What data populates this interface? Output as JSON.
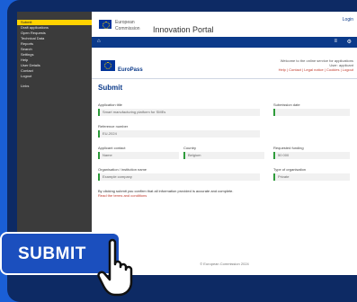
{
  "sidebar": {
    "items": [
      {
        "label": "Submit",
        "active": true
      },
      {
        "label": "Draft applications"
      },
      {
        "label": "Open Requests"
      },
      {
        "label": "Technical Data"
      },
      {
        "label": "Reports"
      },
      {
        "label": "Search"
      },
      {
        "label": "Settings"
      },
      {
        "label": "Help"
      },
      {
        "label": "User Details"
      },
      {
        "label": "Contact"
      },
      {
        "label": "Logout"
      }
    ],
    "section": "Links"
  },
  "header": {
    "org_line1": "European",
    "org_line2": "Commission",
    "portal_title": "Innovation Portal",
    "top_right": "Login"
  },
  "bluebar": {
    "home_glyph": "⌂",
    "right_glyphs": [
      "≡",
      "⚙"
    ]
  },
  "app": {
    "name": "EuroPass",
    "info_line1": "Welcome to the online service for applications",
    "info_line2": "User: applicant",
    "links": "Help | Contact | Legal notice | Cookies | Logout"
  },
  "form": {
    "title": "Submit",
    "fields": [
      {
        "label": "Application title",
        "value": "Smart manufacturing platform for SMEs"
      },
      {
        "label": "Submission date",
        "value": ""
      },
      {
        "label": "Reference number",
        "value": "EU-2024"
      },
      {
        "label": "Applicant contact",
        "value": "Name"
      },
      {
        "label": "Country",
        "value": "Belgium"
      },
      {
        "label": "Requested funding",
        "value": "50 000"
      },
      {
        "label": "Organisation / institution name",
        "value": "Example company"
      },
      {
        "label": "Type of organisation",
        "value": "Private"
      }
    ],
    "note": "By clicking submit you confirm that all information provided is accurate and complete.",
    "note_link": "Read the terms and conditions"
  },
  "footer": "© European Commission 2024",
  "submit_label": "SUBMIT",
  "colors": {
    "background": "#1a5fd6",
    "monitor": "#0d2a64",
    "sidebar": "#3b3b3b",
    "sidebar_active": "#ffd200",
    "accent": "#0b3a8a",
    "field_border": "#2e9b3b"
  }
}
